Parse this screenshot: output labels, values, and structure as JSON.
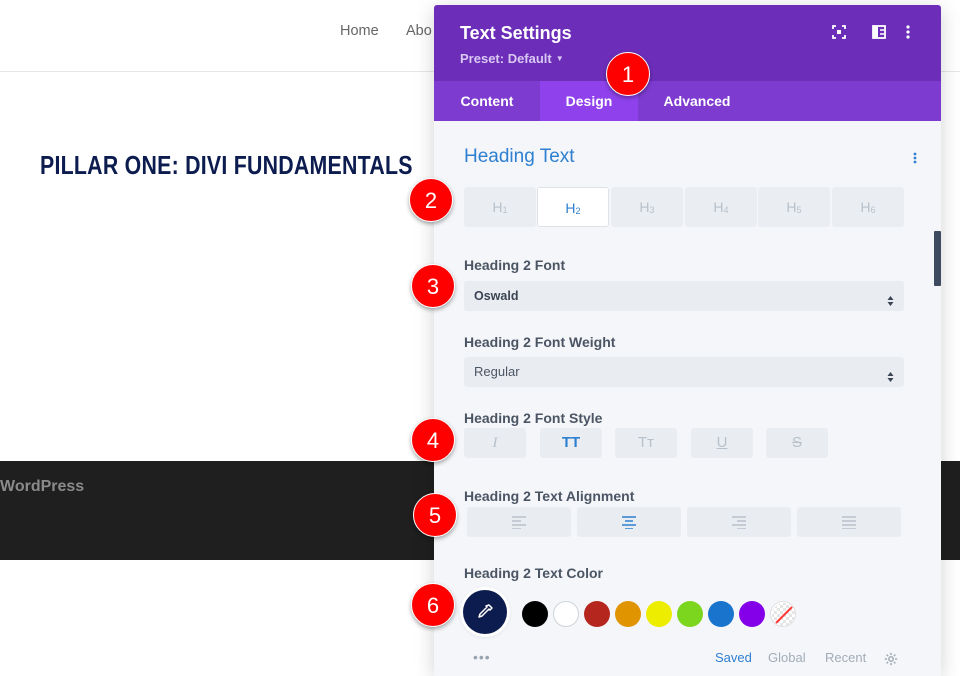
{
  "site": {
    "nav": [
      "Home",
      "Abo"
    ],
    "heading": "PILLAR ONE: DIVI FUNDAMENTALS",
    "footer_text": "WordPress"
  },
  "panel": {
    "title": "Text Settings",
    "preset": "Preset: Default",
    "header_icons": [
      "fullscreen-icon",
      "split-view-icon",
      "more-vertical-icon"
    ],
    "tabs": [
      {
        "label": "Content",
        "active": false
      },
      {
        "label": "Design",
        "active": true
      },
      {
        "label": "Advanced",
        "active": false
      }
    ],
    "section_title": "Heading Text",
    "heading_tabs": [
      {
        "label": "H",
        "sub": "1",
        "active": false
      },
      {
        "label": "H",
        "sub": "2",
        "active": true
      },
      {
        "label": "H",
        "sub": "3",
        "active": false
      },
      {
        "label": "H",
        "sub": "4",
        "active": false
      },
      {
        "label": "H",
        "sub": "5",
        "active": false
      },
      {
        "label": "H",
        "sub": "6",
        "active": false
      }
    ],
    "font_label": "Heading 2 Font",
    "font_value": "Oswald",
    "weight_label": "Heading 2 Font Weight",
    "weight_value": "Regular",
    "style_label": "Heading 2 Font Style",
    "style_buttons": [
      {
        "label": "I",
        "name": "italic",
        "active": false
      },
      {
        "label": "TT",
        "name": "uppercase",
        "active": true
      },
      {
        "label": "Tᴛ",
        "name": "capitalize",
        "active": false
      },
      {
        "label": "U",
        "name": "underline",
        "active": false
      },
      {
        "label": "S",
        "name": "strikethrough",
        "active": false
      }
    ],
    "align_label": "Heading 2 Text Alignment",
    "align_buttons": [
      {
        "name": "left",
        "active": false
      },
      {
        "name": "center",
        "active": true
      },
      {
        "name": "right",
        "active": false
      },
      {
        "name": "justify",
        "active": false
      }
    ],
    "color_label": "Heading 2 Text Color",
    "selected_color": "#0c1c4f",
    "swatches": [
      "#000000",
      "#ffffff",
      "#b5261e",
      "#e09400",
      "#eded00",
      "#7cd61e",
      "#1874cd",
      "#8300e9"
    ],
    "palette_links": [
      {
        "label": "Saved",
        "active": true
      },
      {
        "label": "Global",
        "active": false
      },
      {
        "label": "Recent",
        "active": false
      }
    ]
  },
  "markers": [
    "1",
    "2",
    "3",
    "4",
    "5",
    "6"
  ],
  "colors": {
    "header": "#6c2eb9",
    "tabs": "#7e3bd0",
    "active_tab": "#8f42ec",
    "accent_blue": "#2e7fd0",
    "marker_red": "#ff0000"
  }
}
